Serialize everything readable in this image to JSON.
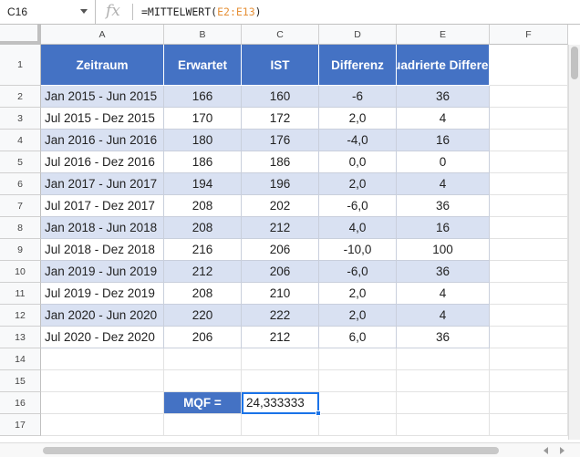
{
  "formula_bar": {
    "name_box": "C16",
    "fx_label": "fx",
    "formula_prefix": "=MITTELWERT(",
    "formula_ref": "E2:E13",
    "formula_suffix": ")"
  },
  "columns": [
    "A",
    "B",
    "C",
    "D",
    "E",
    "F"
  ],
  "rows": [
    "1",
    "2",
    "3",
    "4",
    "5",
    "6",
    "7",
    "8",
    "9",
    "10",
    "11",
    "12",
    "13",
    "14",
    "15",
    "16",
    "17"
  ],
  "table": {
    "headers": [
      "Zeitraum",
      "Erwartet",
      "IST",
      "Differenz",
      "Quadrierte Differenz"
    ],
    "data": [
      [
        "Jan 2015 - Jun 2015",
        "166",
        "160",
        "-6",
        "36"
      ],
      [
        "Jul 2015 - Dez 2015",
        "170",
        "172",
        "2,0",
        "4"
      ],
      [
        "Jan 2016 - Jun 2016",
        "180",
        "176",
        "-4,0",
        "16"
      ],
      [
        "Jul 2016 - Dez 2016",
        "186",
        "186",
        "0,0",
        "0"
      ],
      [
        "Jan 2017 - Jun 2017",
        "194",
        "196",
        "2,0",
        "4"
      ],
      [
        "Jul 2017 - Dez 2017",
        "208",
        "202",
        "-6,0",
        "36"
      ],
      [
        "Jan 2018 - Jun 2018",
        "208",
        "212",
        "4,0",
        "16"
      ],
      [
        "Jul 2018 - Dez 2018",
        "216",
        "206",
        "-10,0",
        "100"
      ],
      [
        "Jan 2019 - Jun 2019",
        "212",
        "206",
        "-6,0",
        "36"
      ],
      [
        "Jul 2019 - Dez 2019",
        "208",
        "210",
        "2,0",
        "4"
      ],
      [
        "Jan 2020 - Jun 2020",
        "220",
        "222",
        "2,0",
        "4"
      ],
      [
        "Jul 2020 - Dez 2020",
        "206",
        "212",
        "6,0",
        "36"
      ]
    ]
  },
  "mqf": {
    "label": "MQF =",
    "value": "24,333333"
  },
  "colors": {
    "header_fill": "#4472c4",
    "band_fill": "#d9e1f2",
    "selection": "#1a73e8"
  }
}
